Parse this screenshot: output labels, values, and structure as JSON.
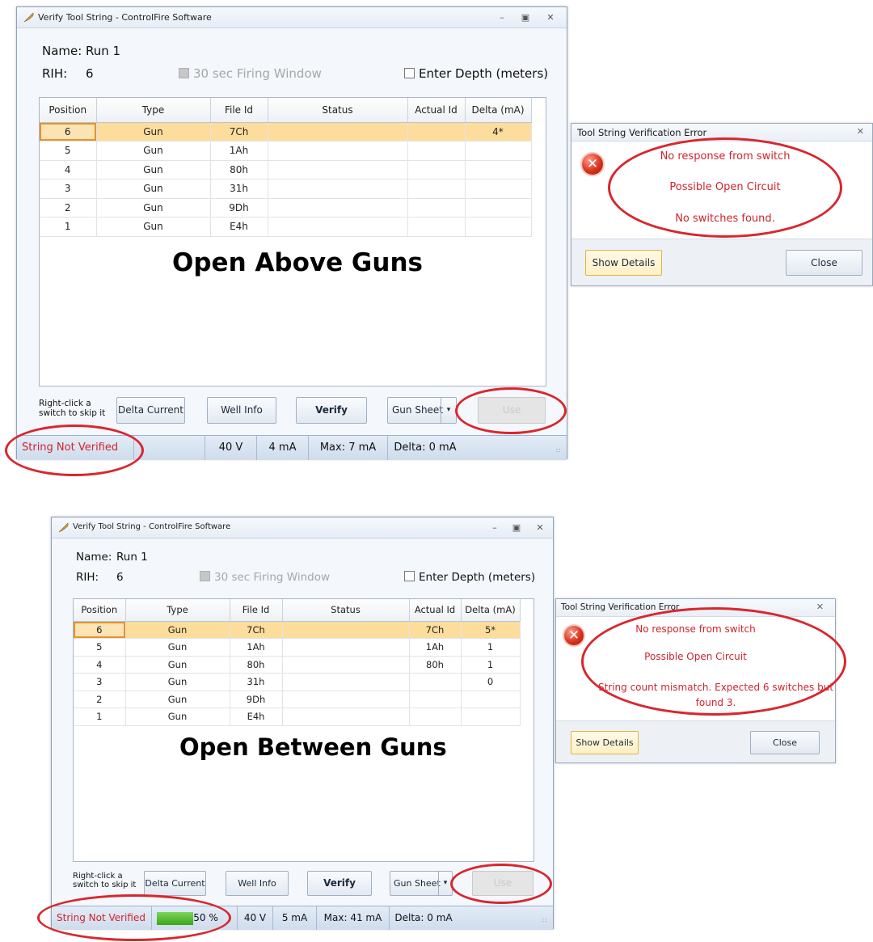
{
  "top": {
    "window_title": "Verify Tool String - ControlFire Software",
    "name_label": "Name:",
    "name_value": "Run 1",
    "rih_label": "RIH:",
    "rih_value": "6",
    "firing_window": "30 sec Firing Window",
    "enter_depth": "Enter Depth (meters)",
    "columns": [
      "Position",
      "Type",
      "File Id",
      "Status",
      "Actual Id",
      "Delta (mA)"
    ],
    "rows": [
      {
        "pos": "6",
        "type": "Gun",
        "file_id": "7Ch",
        "status": "",
        "actual": "",
        "delta": "4*"
      },
      {
        "pos": "5",
        "type": "Gun",
        "file_id": "1Ah",
        "status": "",
        "actual": "",
        "delta": ""
      },
      {
        "pos": "4",
        "type": "Gun",
        "file_id": "80h",
        "status": "",
        "actual": "",
        "delta": ""
      },
      {
        "pos": "3",
        "type": "Gun",
        "file_id": "31h",
        "status": "",
        "actual": "",
        "delta": ""
      },
      {
        "pos": "2",
        "type": "Gun",
        "file_id": "9Dh",
        "status": "",
        "actual": "",
        "delta": ""
      },
      {
        "pos": "1",
        "type": "Gun",
        "file_id": "E4h",
        "status": "",
        "actual": "",
        "delta": ""
      }
    ],
    "overlay": "Open Above Guns",
    "hint": "Right-click a switch to skip it",
    "buttons": {
      "delta": "Delta Current",
      "well": "Well Info",
      "verify": "Verify",
      "gun": "Gun Sheet",
      "use": "Use"
    },
    "status": {
      "state": "String Not Verified",
      "progress": "",
      "volts": "40 V",
      "ma": "4 mA",
      "max": "Max: 7 mA",
      "delta": "Delta: 0 mA"
    },
    "dialog": {
      "title": "Tool String Verification Error",
      "lines": [
        "No response from switch",
        "Possible Open Circuit",
        "No switches found."
      ],
      "show_details": "Show Details",
      "close": "Close"
    }
  },
  "bottom": {
    "window_title": "Verify Tool String - ControlFire Software",
    "name_label": "Name:",
    "name_value": "Run 1",
    "rih_label": "RIH:",
    "rih_value": "6",
    "firing_window": "30 sec Firing Window",
    "enter_depth": "Enter Depth (meters)",
    "columns": [
      "Position",
      "Type",
      "File Id",
      "Status",
      "Actual Id",
      "Delta (mA)"
    ],
    "rows": [
      {
        "pos": "6",
        "type": "Gun",
        "file_id": "7Ch",
        "status": "",
        "actual": "7Ch",
        "delta": "5*"
      },
      {
        "pos": "5",
        "type": "Gun",
        "file_id": "1Ah",
        "status": "",
        "actual": "1Ah",
        "delta": "1"
      },
      {
        "pos": "4",
        "type": "Gun",
        "file_id": "80h",
        "status": "",
        "actual": "80h",
        "delta": "1"
      },
      {
        "pos": "3",
        "type": "Gun",
        "file_id": "31h",
        "status": "",
        "actual": "",
        "delta": "0"
      },
      {
        "pos": "2",
        "type": "Gun",
        "file_id": "9Dh",
        "status": "",
        "actual": "",
        "delta": ""
      },
      {
        "pos": "1",
        "type": "Gun",
        "file_id": "E4h",
        "status": "",
        "actual": "",
        "delta": ""
      }
    ],
    "overlay": "Open Between Guns",
    "hint": "Right-click a switch to skip it",
    "buttons": {
      "delta": "Delta Current",
      "well": "Well Info",
      "verify": "Verify",
      "gun": "Gun Sheet",
      "use": "Use"
    },
    "status": {
      "state": "String Not Verified",
      "progress": "50 %",
      "progress_fraction": 0.5,
      "volts": "40 V",
      "ma": "5 mA",
      "max": "Max: 41 mA",
      "delta": "Delta: 0 mA"
    },
    "dialog": {
      "title": "Tool String Verification Error",
      "lines": [
        "No response from switch",
        "Possible Open Circuit",
        "String count mismatch. Expected 6 switches but found 3."
      ],
      "show_details": "Show Details",
      "close": "Close"
    }
  },
  "colors": {
    "annotation_ring": "#d9262e",
    "error_text": "#d0242d",
    "selected_row": "#fddd9c",
    "progress_green": "#3aa51c"
  }
}
